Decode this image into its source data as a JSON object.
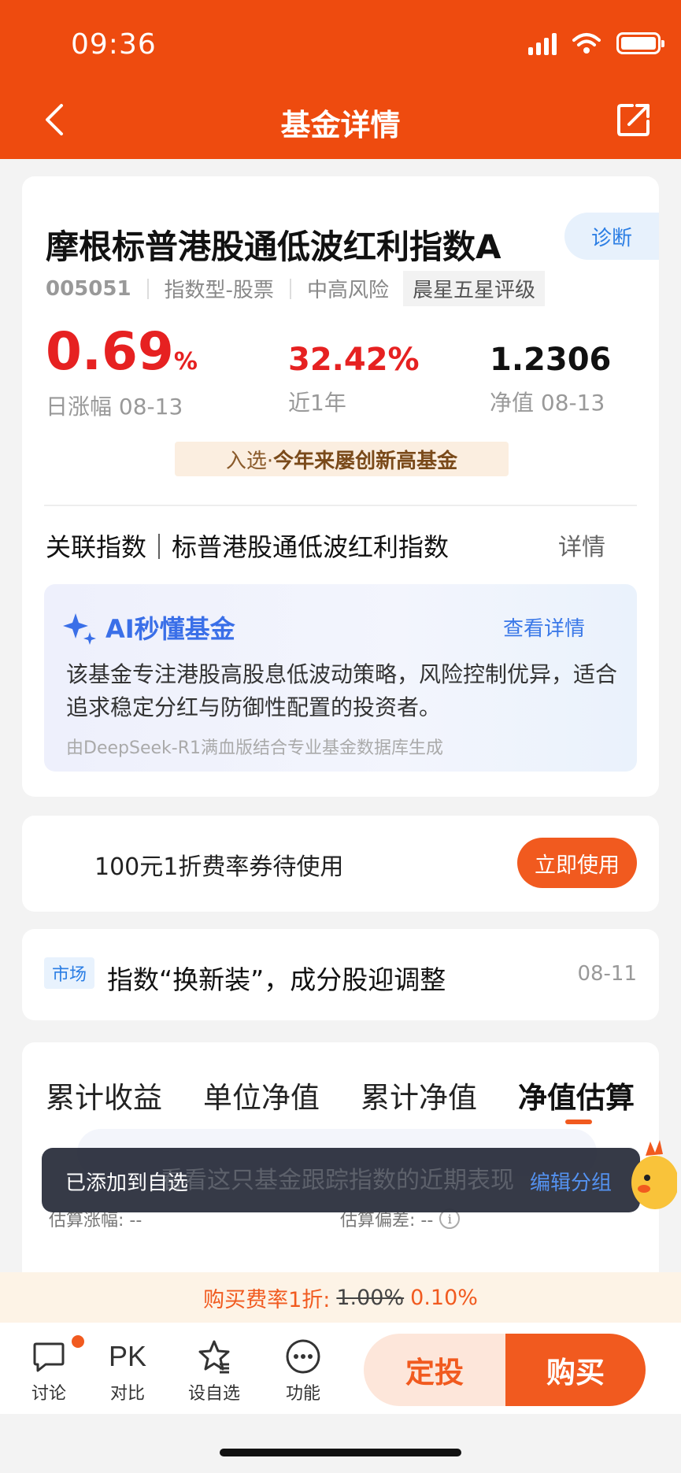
{
  "status_bar": {
    "time": "09:36"
  },
  "nav": {
    "title": "基金详情"
  },
  "fund": {
    "name": "摩根标普港股通低波红利指数A",
    "diagnose_label": "诊断",
    "code": "005051",
    "type": "指数型-股票",
    "risk": "中高风险",
    "rating": "晨星五星评级",
    "daily_change_value": "0.69",
    "daily_change_unit": "%",
    "daily_change_label": "日涨幅 08-13",
    "year_return_value": "32.42%",
    "year_return_label": "近1年",
    "nav_value": "1.2306",
    "nav_label": "净值 08-13",
    "selected_prefix": "入选·",
    "selected_text": "今年来屡创新高基金",
    "related_index": "关联指数｜标普港股通低波红利指数",
    "related_detail": "详情"
  },
  "ai": {
    "title": "AI秒懂基金",
    "more": "查看详情",
    "text": "该基金专注港股高股息低波动策略，风险控制优异，适合追求稳定分红与防御性配置的投资者。",
    "source": "由DeepSeek-R1满血版结合专业基金数据库生成"
  },
  "coupon": {
    "text": "100元1折费率券待使用",
    "button": "立即使用"
  },
  "news": {
    "tag": "市场",
    "text": "指数“换新装”，成分股迎调整",
    "date": "08-11"
  },
  "tabs": {
    "items": [
      "累计收益",
      "单位净值",
      "累计净值",
      "净值估算"
    ],
    "active": "净值估算",
    "est_change": "估算涨幅: --",
    "est_deviation": "估算偏差: --",
    "hint_behind": "看看这只基金跟踪指数的近期表现"
  },
  "toast": {
    "text": "已添加到自选",
    "link": "编辑分组"
  },
  "fee_bar": {
    "label": "购买费率1折:",
    "old": "1.00%",
    "new": "0.10%"
  },
  "bottom": {
    "discuss": "讨论",
    "pk_icon_text": "PK",
    "compare": "对比",
    "watchlist": "设自选",
    "functions": "功能",
    "auto_invest": "定投",
    "buy": "购买"
  },
  "colors": {
    "brand": "#ee4b0f",
    "accent": "#f15a1f",
    "up": "#e62121",
    "link": "#2b7ee4"
  }
}
